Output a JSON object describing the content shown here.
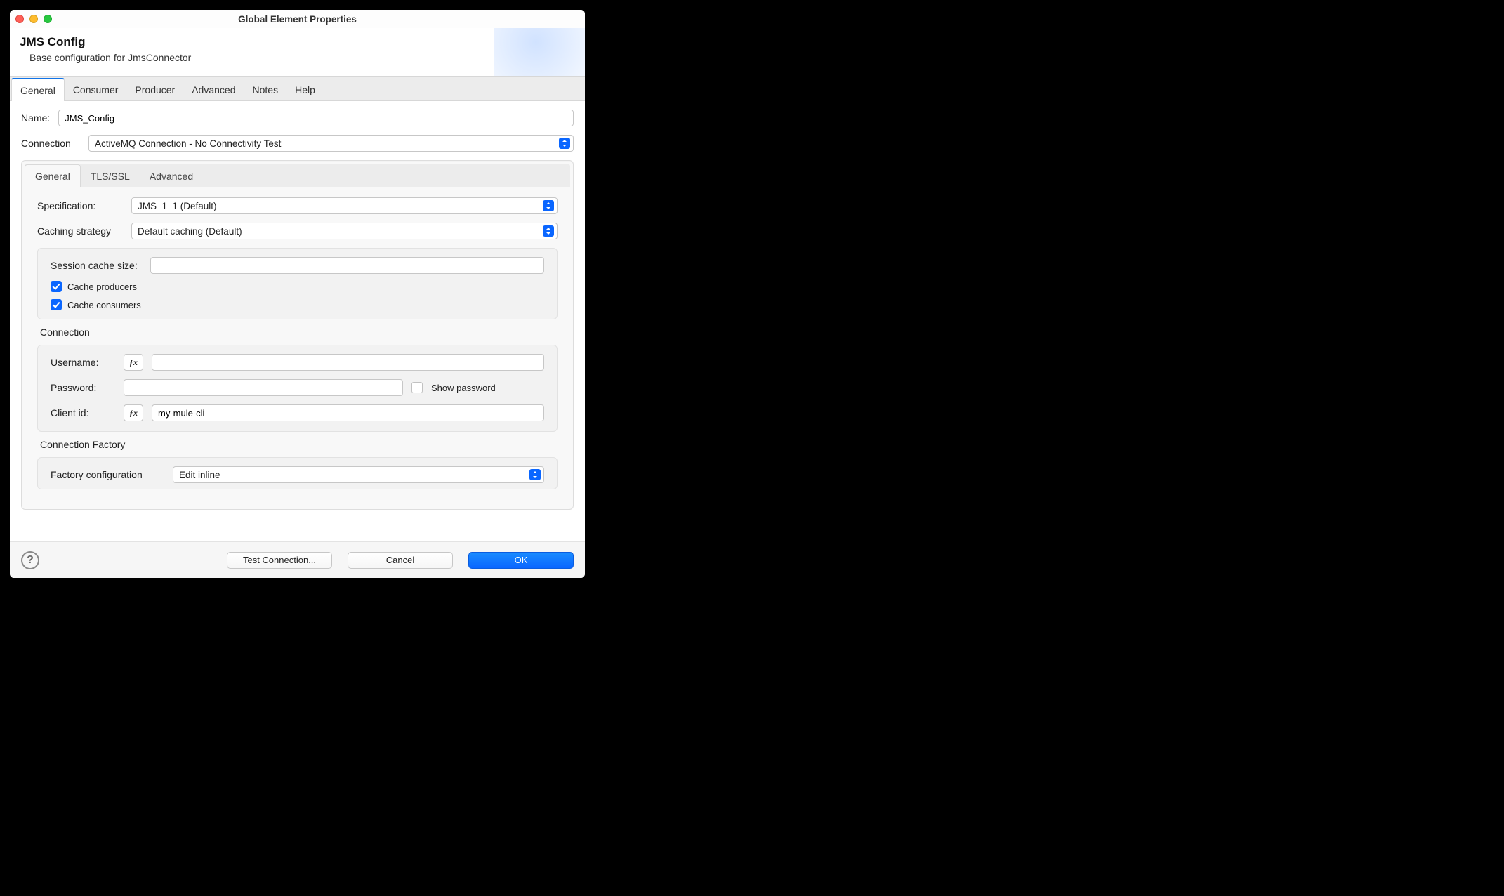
{
  "window": {
    "title": "Global Element Properties"
  },
  "header": {
    "title": "JMS Config",
    "subtitle": "Base configuration for JmsConnector"
  },
  "outerTabs": [
    "General",
    "Consumer",
    "Producer",
    "Advanced",
    "Notes",
    "Help"
  ],
  "form": {
    "name_label": "Name:",
    "name_value": "JMS_Config",
    "connection_label": "Connection",
    "connection_value": "ActiveMQ Connection - No Connectivity Test"
  },
  "innerTabs": [
    "General",
    "TLS/SSL",
    "Advanced"
  ],
  "general": {
    "specification_label": "Specification:",
    "specification_value": "JMS_1_1 (Default)",
    "caching_label": "Caching strategy",
    "caching_value": "Default caching (Default)",
    "session_cache_label": "Session cache size:",
    "session_cache_value": "",
    "cache_producers_label": "Cache producers",
    "cache_consumers_label": "Cache consumers",
    "connection_section": "Connection",
    "username_label": "Username:",
    "username_value": "",
    "password_label": "Password:",
    "password_value": "",
    "show_password_label": "Show password",
    "clientid_label": "Client id:",
    "clientid_value": "my-mule-cli",
    "factory_section": "Connection Factory",
    "factory_config_label": "Factory configuration",
    "factory_config_value": "Edit inline"
  },
  "footer": {
    "test": "Test Connection...",
    "cancel": "Cancel",
    "ok": "OK"
  }
}
